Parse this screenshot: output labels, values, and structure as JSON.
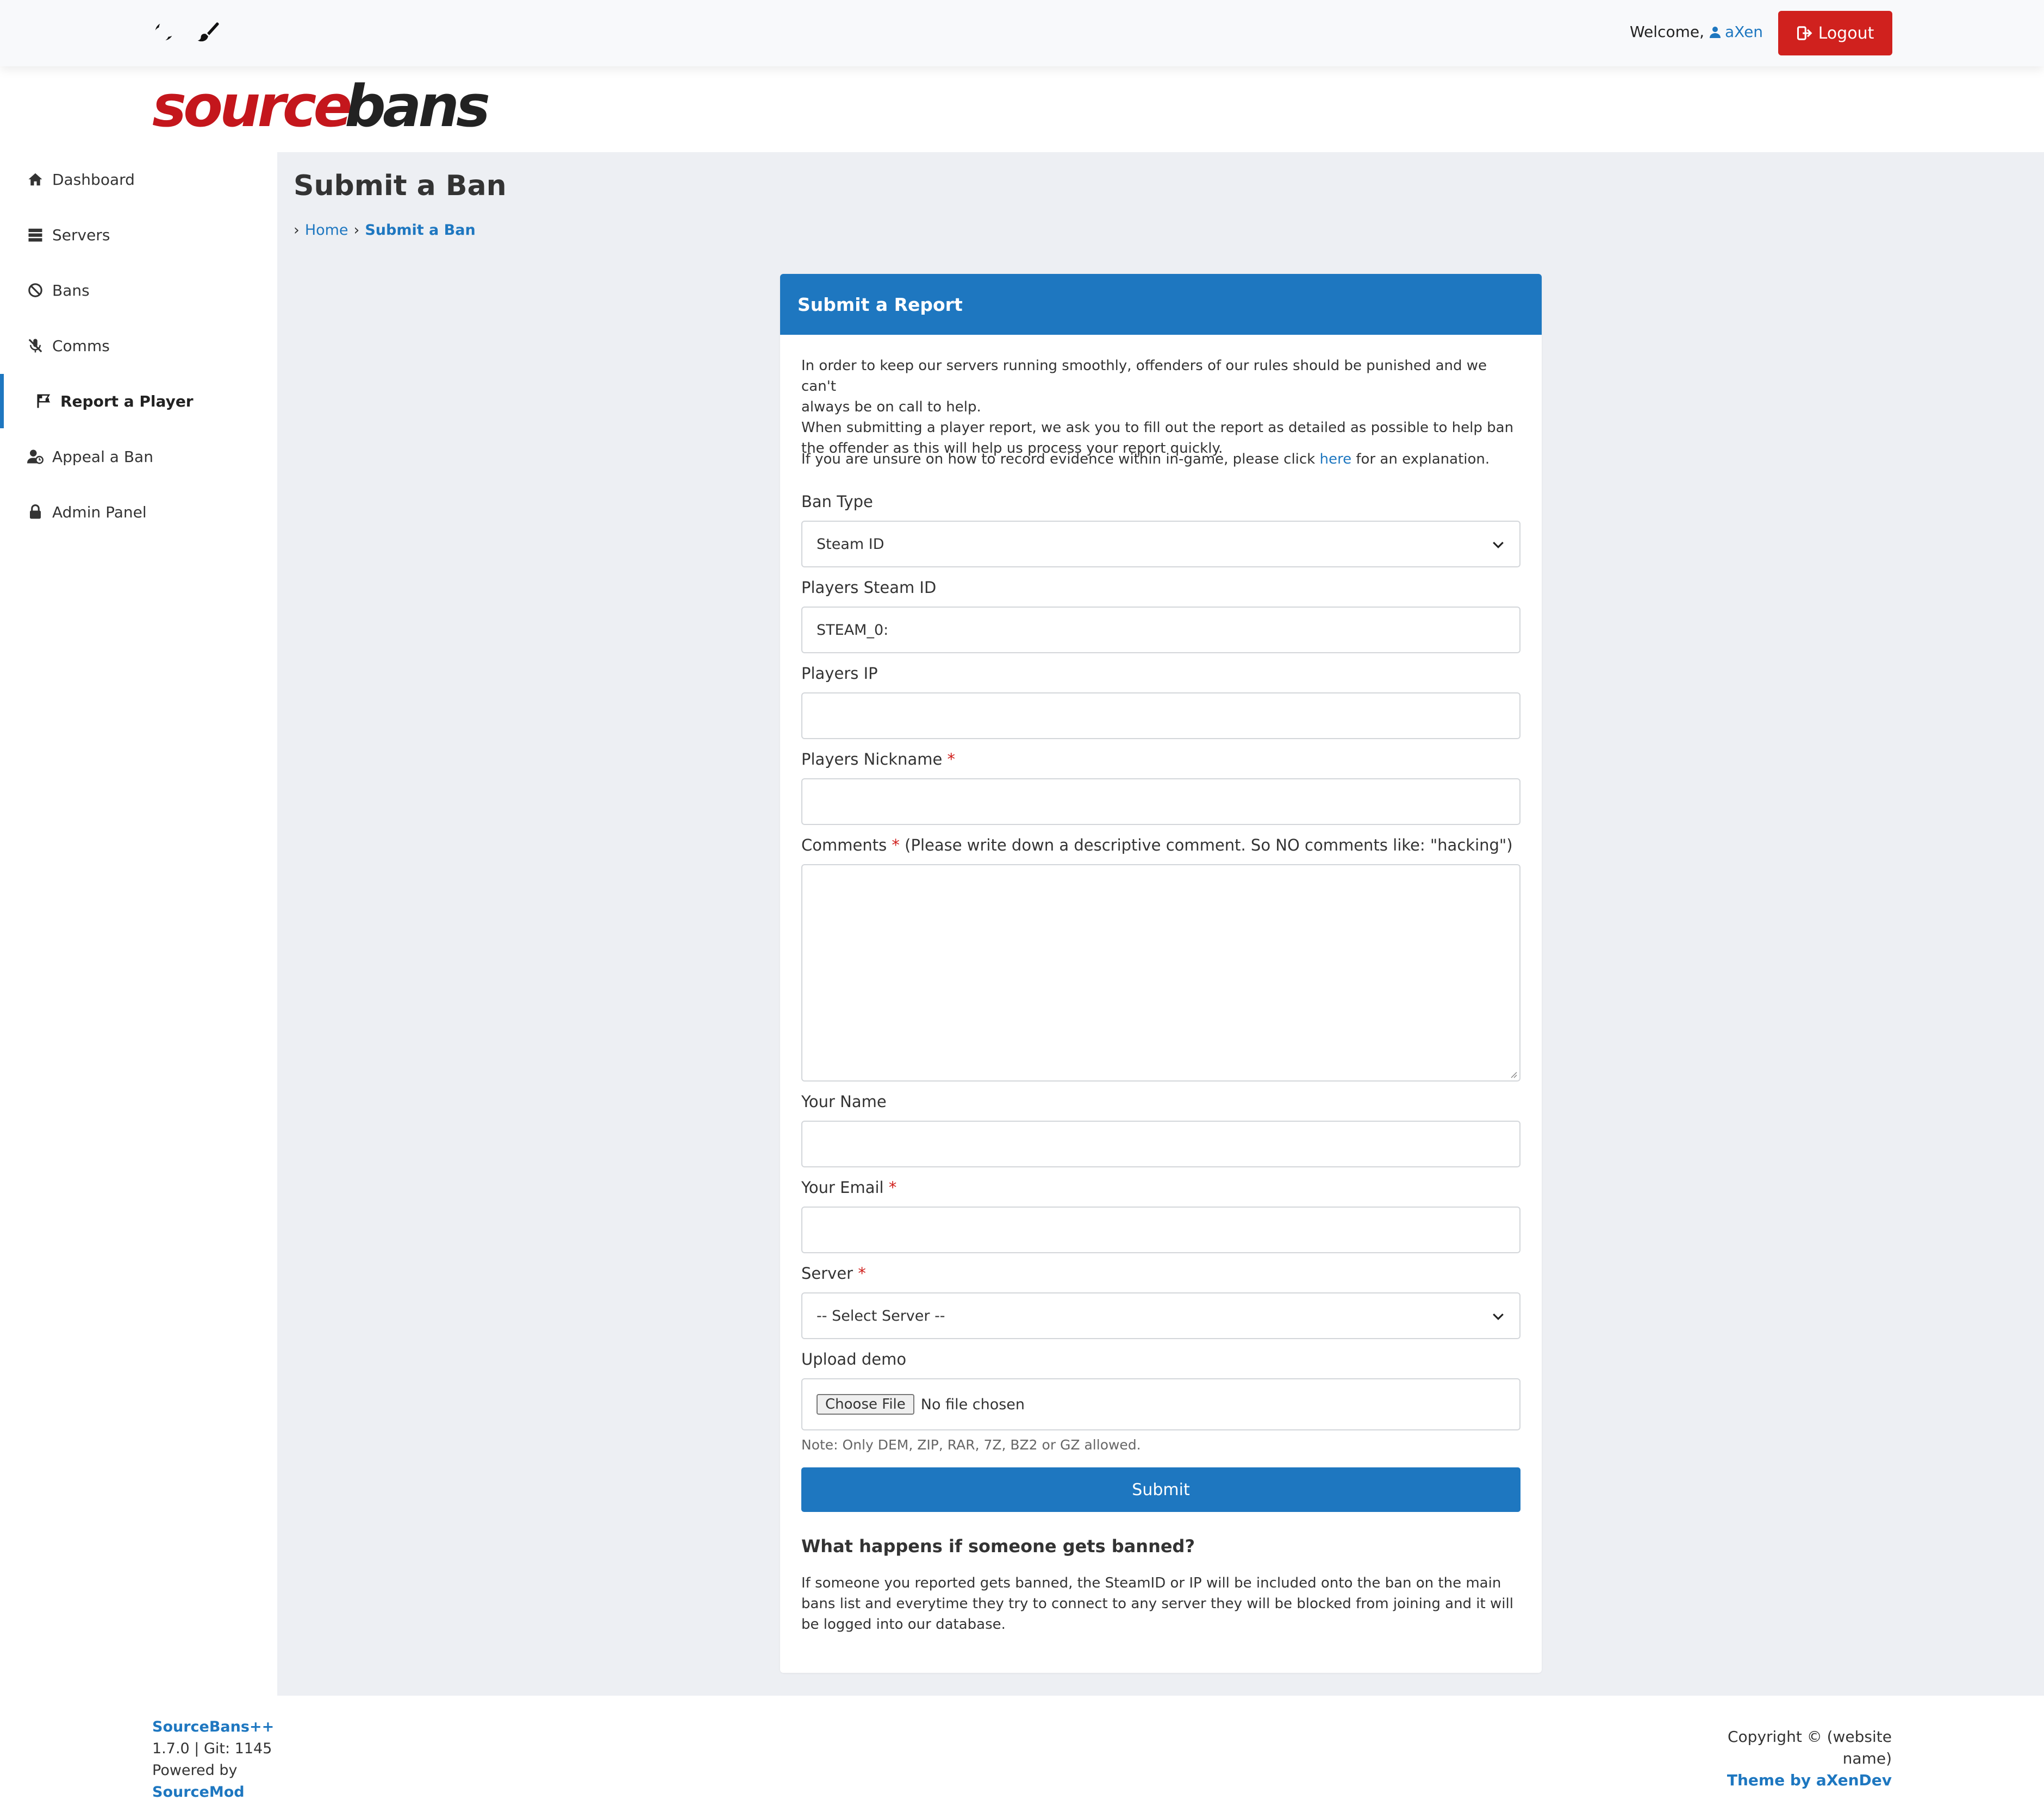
{
  "topbar": {
    "welcome_label": "Welcome,",
    "username": "aXen",
    "logout_label": "Logout",
    "icons": [
      "moon-icon",
      "brush-icon",
      "user-icon",
      "logout-icon"
    ]
  },
  "logo": {
    "part1": "source",
    "part2": "bans",
    "color1": "#c4161c",
    "color2": "#222222"
  },
  "sidebar": {
    "items": [
      {
        "label": "Dashboard",
        "icon": "home-icon"
      },
      {
        "label": "Servers",
        "icon": "server-icon"
      },
      {
        "label": "Bans",
        "icon": "ban-icon"
      },
      {
        "label": "Comms",
        "icon": "mute-mic-icon"
      },
      {
        "label": "Report a Player",
        "icon": "flag-icon",
        "active": true
      },
      {
        "label": "Appeal a Ban",
        "icon": "user-clock-icon"
      },
      {
        "label": "Admin Panel",
        "icon": "lock-icon"
      }
    ]
  },
  "page": {
    "title": "Submit a Ban",
    "breadcrumb": {
      "home": "Home",
      "current": "Submit a Ban"
    }
  },
  "card": {
    "header": "Submit a Report",
    "intro_line1": "In order to keep our servers running smoothly, offenders of our rules should be punished and we can't",
    "intro_line2": "always be on call to help.",
    "intro_line3": "When submitting a player report, we ask you to fill out the report as detailed as possible to help ban",
    "intro_line4": "the offender as this will help us process your report quickly.",
    "evidence_prefix": "If you are unsure on how to record evidence within in-game, please click",
    "evidence_link": "here",
    "evidence_suffix": "for an explanation.",
    "ban_type_label": "Ban Type",
    "ban_type_value": "Steam ID",
    "steam_id_label": "Players Steam ID",
    "steam_id_value": "STEAM_0:",
    "ip_label": "Players IP",
    "ip_value": "",
    "nickname_label": "Players Nickname",
    "comments_label": "Comments",
    "comments_hint": "(Please write down a descriptive comment. So NO comments like: \"hacking\")",
    "your_name_label": "Your Name",
    "your_email_label": "Your Email",
    "server_label": "Server",
    "server_value": "-- Select Server --",
    "upload_label": "Upload demo",
    "choose_file": "Choose File",
    "no_file": "No file chosen",
    "note": "Note: Only DEM, ZIP, RAR, 7Z, BZ2 or GZ allowed.",
    "submit_label": "Submit",
    "banned_heading": "What happens if someone gets banned?",
    "banned_line1": "If someone you reported gets banned, the SteamID or IP will be included onto the ban on the main",
    "banned_line2": "bans list and everytime they try to connect to any server they will be blocked from joining and it will",
    "banned_line3": "be logged into our database."
  },
  "footer": {
    "brand": "SourceBans++",
    "version": "1.7.0 | Git: 1145",
    "powered": "Powered by",
    "sourcemod": "SourceMod",
    "copyright_line1": "Copyright © (website",
    "copyright_line2": "name)",
    "theme": "Theme by aXenDev"
  },
  "colors": {
    "accent": "#1e77c0",
    "danger": "#d0211e",
    "main_bg": "#edeff3"
  }
}
